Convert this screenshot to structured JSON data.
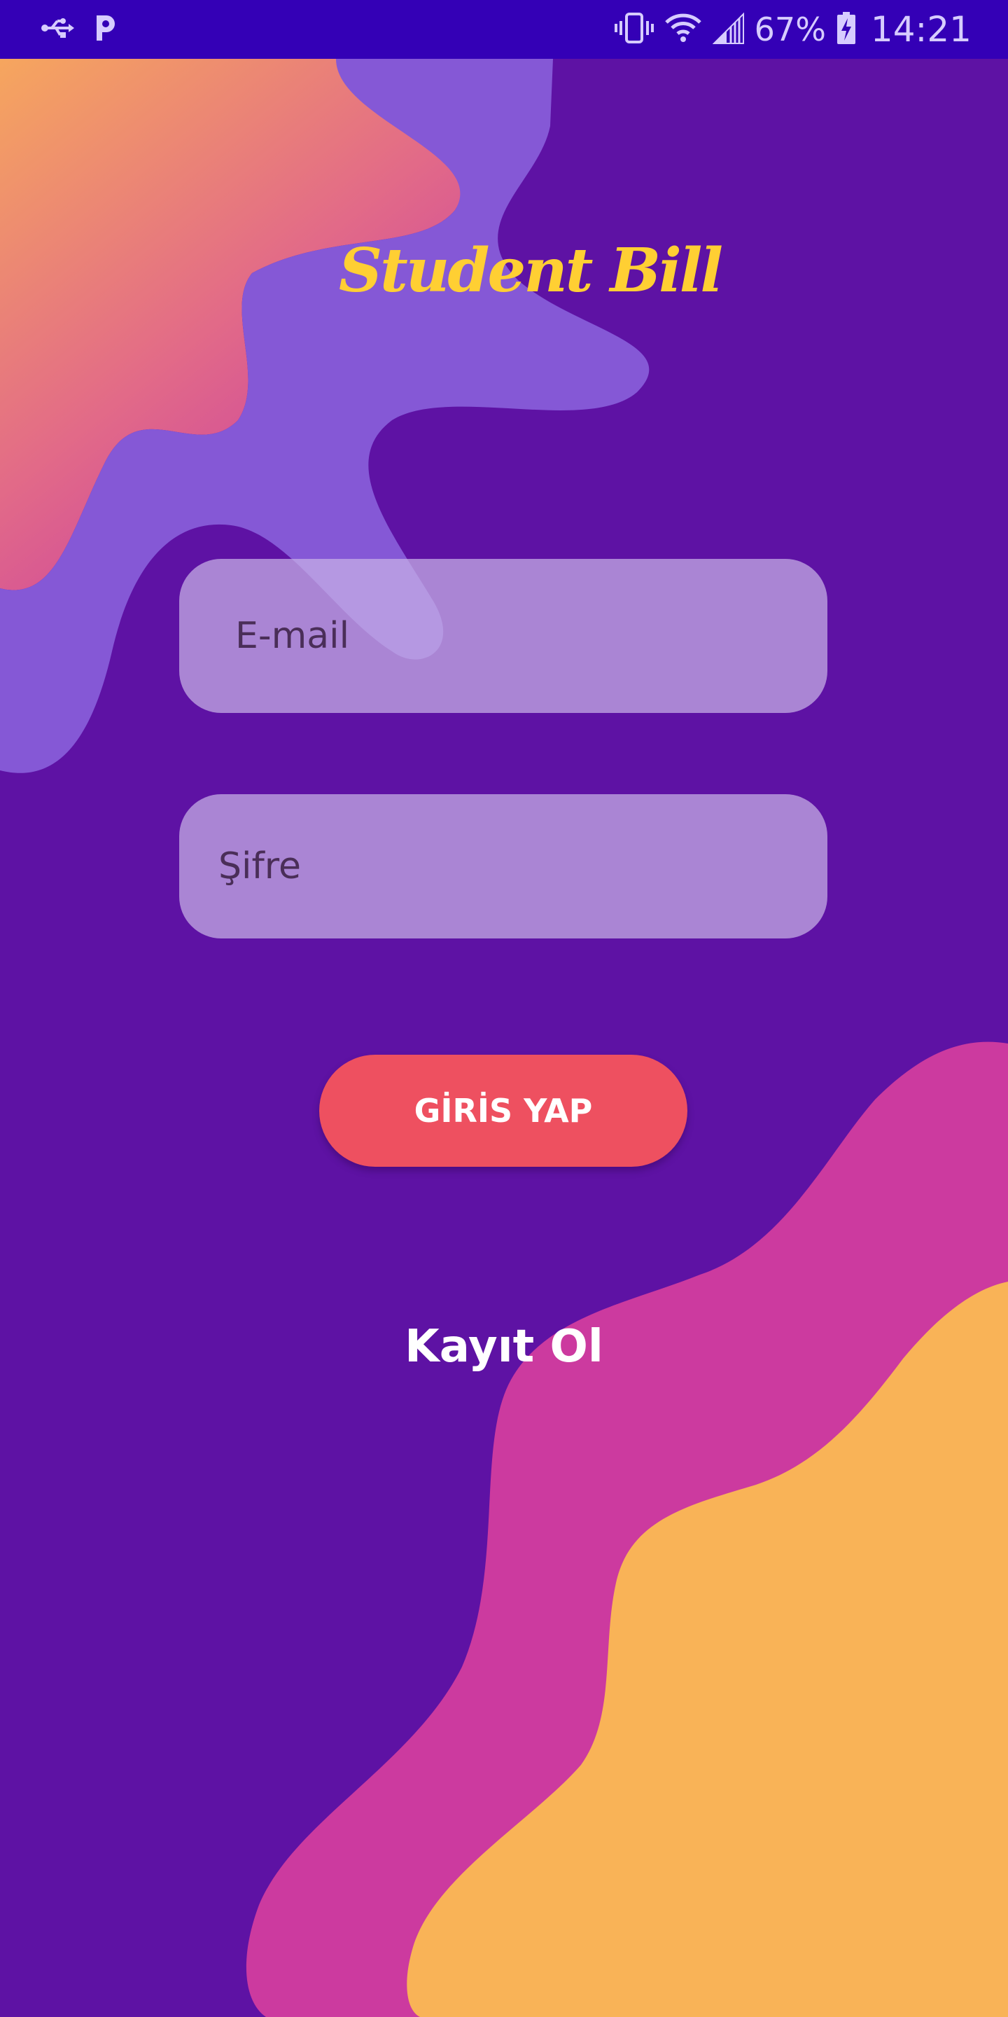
{
  "status_bar": {
    "battery_percent": "67%",
    "time": "14:21",
    "icons": [
      "usb-icon",
      "pocket-app-icon",
      "vibrate-icon",
      "wifi-icon",
      "signal-icon",
      "battery-charging-icon"
    ]
  },
  "app": {
    "title": "Student Bill"
  },
  "login_form": {
    "email_placeholder": "E-mail",
    "password_placeholder": "Şifre",
    "login_button_label": "GİRİS YAP",
    "register_link_label": "Kayıt Ol"
  },
  "colors": {
    "background": "#5e12a4",
    "status_bar": "#3400b6",
    "title": "#ffcf33",
    "button": "#ee5060",
    "blob_magenta": "#cc3a9f",
    "blob_orange": "#f9b357",
    "blob_lavender": "#8558d6"
  }
}
